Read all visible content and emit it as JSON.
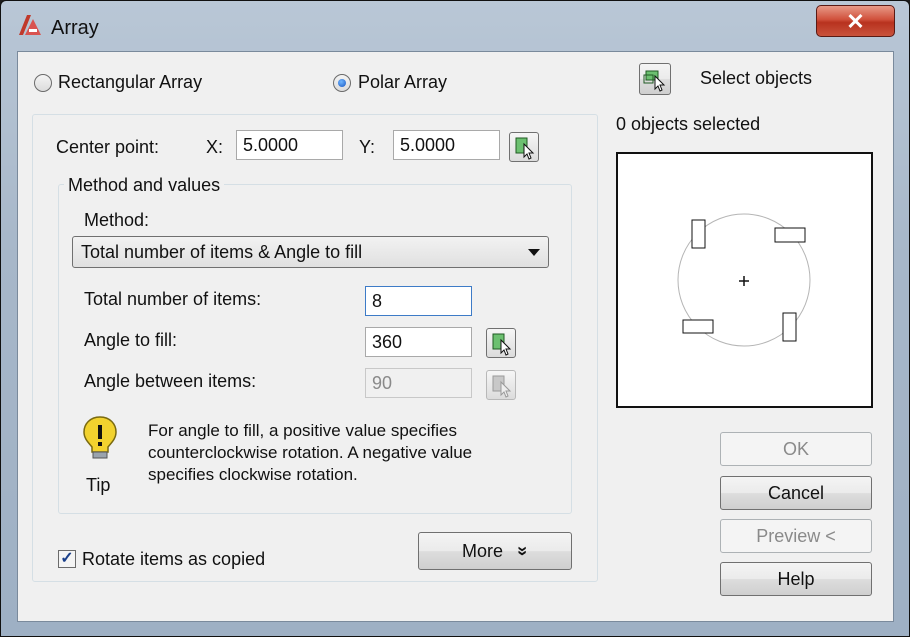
{
  "window": {
    "title": "Array",
    "close_glyph": "✕"
  },
  "array_type": {
    "rectangular_label": "Rectangular Array",
    "polar_label": "Polar Array",
    "selected": "Polar Array"
  },
  "center_point": {
    "label": "Center point:",
    "x_label": "X:",
    "x_value": "5.0000",
    "y_label": "Y:",
    "y_value": "5.0000"
  },
  "method_group": {
    "title": "Method and values",
    "method_label": "Method:",
    "method_value": "Total number of items & Angle to fill",
    "total_items_label": "Total number of items:",
    "total_items_value": "8",
    "angle_fill_label": "Angle to fill:",
    "angle_fill_value": "360",
    "angle_between_label": "Angle between items:",
    "angle_between_value": "90"
  },
  "tip": {
    "caption": "Tip",
    "line1": "For angle to fill, a positive value specifies",
    "line2": "counterclockwise rotation.  A negative value",
    "line3": "specifies clockwise rotation."
  },
  "rotate_items": {
    "label": "Rotate items as copied",
    "checked": true,
    "check_glyph": "✓"
  },
  "more_button": {
    "label": "More",
    "icon": "double-chevron-down-icon",
    "glyph": "»"
  },
  "select_objects": {
    "label": "Select objects",
    "status": "0 objects selected"
  },
  "buttons": {
    "ok": "OK",
    "cancel": "Cancel",
    "preview": "Preview <",
    "help": "Help"
  },
  "colors": {
    "pick_icon_fill": "#4caf50",
    "title_icon": "#c0392b",
    "tip_bulb": "#f2d22e"
  }
}
